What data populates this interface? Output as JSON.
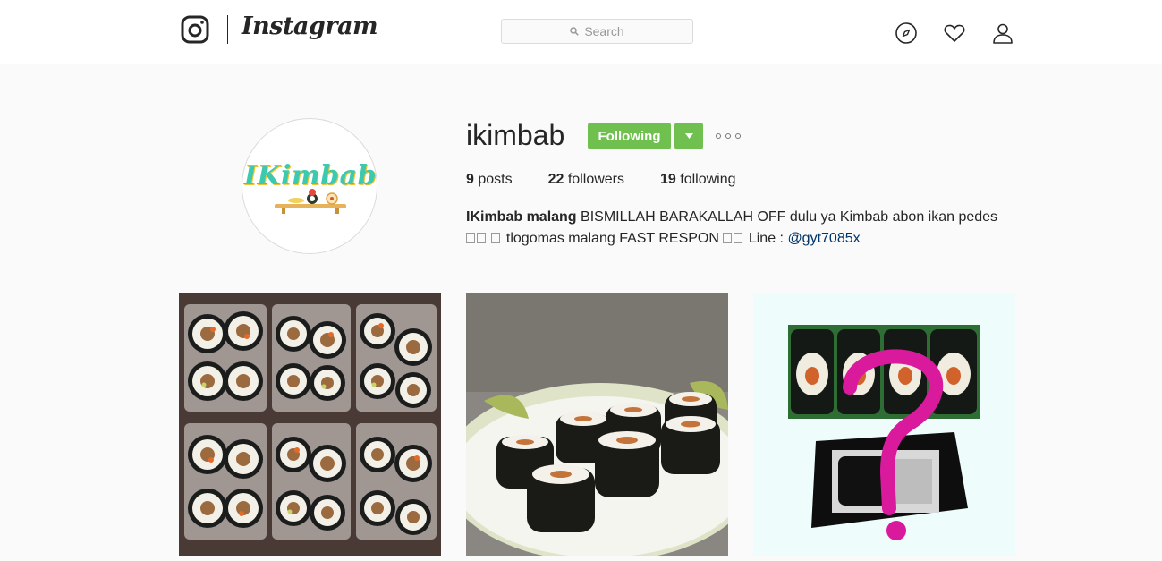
{
  "topbar": {
    "wordmark": "Instagram",
    "search_placeholder": "Search"
  },
  "profile": {
    "avatar_text": "IKimbab",
    "username": "ikimbab",
    "follow_button": "Following",
    "stats": {
      "posts_count": "9",
      "posts_label": "posts",
      "followers_count": "22",
      "followers_label": "followers",
      "following_count": "19",
      "following_label": "following"
    },
    "bio": {
      "name": "IKimbab malang",
      "line1": "BISMILLAH BARAKALLAH OFF dulu ya Kimbab abon ikan pedes",
      "line2": "tlogomas malang FAST RESPON",
      "line2_suffix": "Line :",
      "handle": "@gyt7085x"
    }
  },
  "posts": [
    {
      "name": "kimbab-trays"
    },
    {
      "name": "kimbab-plate"
    },
    {
      "name": "kimbab-question"
    }
  ],
  "colors": {
    "accent": "#70c050",
    "link": "#003569",
    "question_mark": "#d91a9c"
  },
  "icons": {
    "logo": "instagram-camera-icon",
    "search": "search-icon",
    "explore": "compass-icon",
    "activity": "heart-icon",
    "profile": "user-icon",
    "dropdown": "caret-down-icon",
    "more": "more-options-icon"
  }
}
